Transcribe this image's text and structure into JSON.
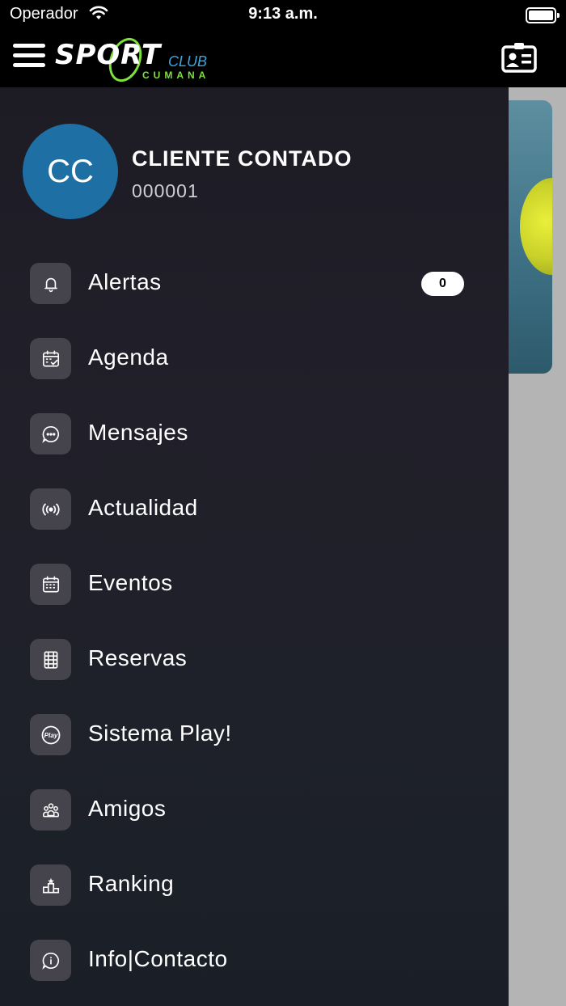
{
  "status_bar": {
    "carrier": "Operador",
    "time": "9:13 a.m."
  },
  "header": {
    "logo": {
      "word": "SPORT",
      "club": "CLUB",
      "city": "CUMANA"
    },
    "menu_icon": "hamburger-icon",
    "contact_icon": "id-card-icon"
  },
  "profile": {
    "initials": "CC",
    "name": "CLIENTE CONTADO",
    "code": "000001",
    "avatar_color": "#1e6fa3"
  },
  "menu": [
    {
      "label": "Alertas",
      "icon": "bell-icon",
      "badge": "0"
    },
    {
      "label": "Agenda",
      "icon": "calendar-check-icon"
    },
    {
      "label": "Mensajes",
      "icon": "chat-bubble-icon"
    },
    {
      "label": "Actualidad",
      "icon": "broadcast-icon"
    },
    {
      "label": "Eventos",
      "icon": "calendar-grid-icon"
    },
    {
      "label": "Reservas",
      "icon": "court-icon"
    },
    {
      "label": "Sistema Play!",
      "icon": "play-logo-icon"
    },
    {
      "label": "Amigos",
      "icon": "friends-icon"
    },
    {
      "label": "Ranking",
      "icon": "podium-icon"
    },
    {
      "label": "Info|Contacto",
      "icon": "info-bubble-icon"
    }
  ],
  "colors": {
    "drawer": "#1f1d27",
    "icon_tile": "#45444c",
    "accent_green": "#7ee23a",
    "accent_blue": "#3aa6e0"
  }
}
